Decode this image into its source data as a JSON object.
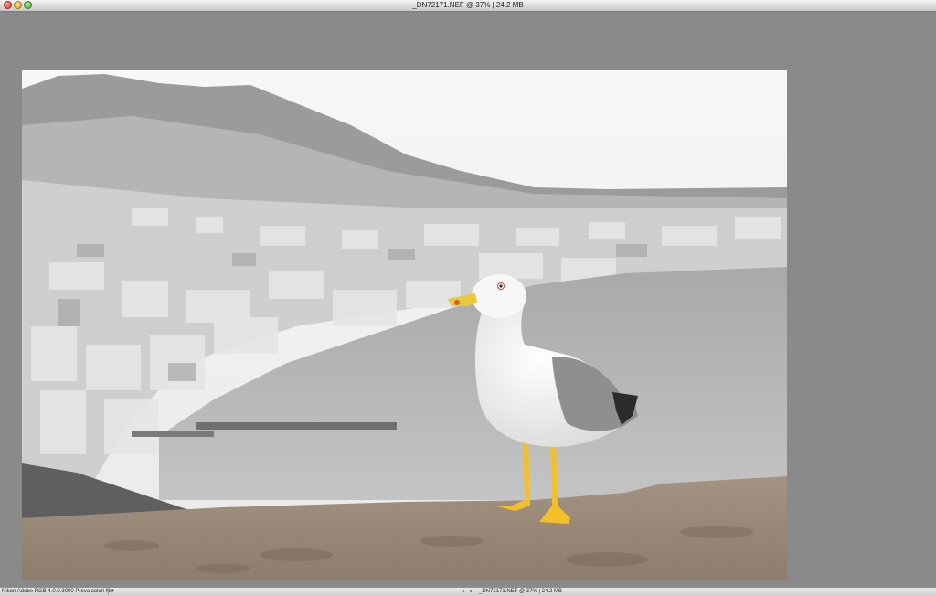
{
  "window": {
    "title": "_DN72171.NEF @ 37% | 24.2 MB"
  },
  "statusbar": {
    "profile_info": "Nikon Adobe RGB 4.0.0.3000  Prova colori No",
    "dropdown_glyph": "▼",
    "prev_glyph": "◂",
    "next_glyph": "▸",
    "doc_info": "_DN72171.NEF @ 37% | 24.2 MB"
  },
  "icons": {
    "close": "close-icon",
    "minimize": "minimize-icon",
    "zoom": "zoom-icon",
    "dropdown": "chevron-down-icon"
  },
  "colors": {
    "canvas_background": "#8a8a8a",
    "beak": "#e9c83a",
    "feet": "#f2c12a"
  }
}
